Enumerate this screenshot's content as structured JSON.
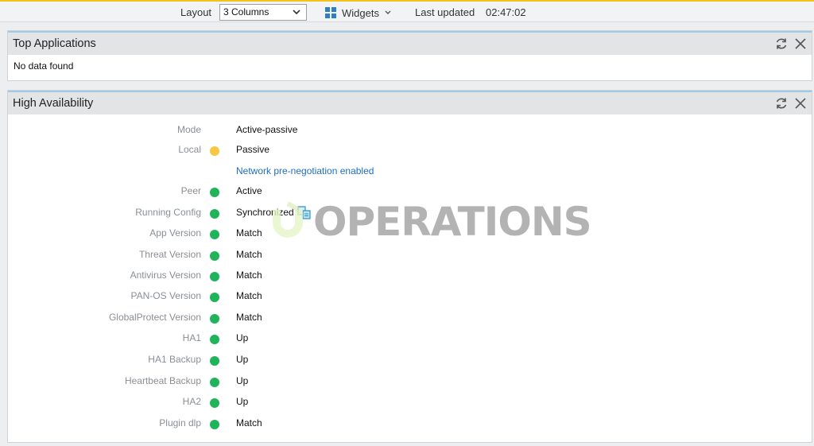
{
  "toolbar": {
    "layout_label": "Layout",
    "layout_value": "3 Columns",
    "widgets_label": "Widgets",
    "last_updated_label": "Last updated",
    "last_updated_value": "02:47:02"
  },
  "top_applications": {
    "title": "Top Applications",
    "empty_message": "No data found"
  },
  "high_availability": {
    "title": "High Availability",
    "rows": [
      {
        "label": "Mode",
        "status": null,
        "value": "Active-passive"
      },
      {
        "label": "Local",
        "status": "yellow",
        "value": "Passive"
      },
      {
        "label": "",
        "status": null,
        "value": "Network pre-negotiation enabled",
        "link": true
      },
      {
        "label": "Peer",
        "status": "green",
        "value": "Active"
      },
      {
        "label": "Running Config",
        "status": "green",
        "value": "Synchronized"
      },
      {
        "label": "App Version",
        "status": "green",
        "value": "Match"
      },
      {
        "label": "Threat Version",
        "status": "green",
        "value": "Match"
      },
      {
        "label": "Antivirus Version",
        "status": "green",
        "value": "Match"
      },
      {
        "label": "PAN-OS Version",
        "status": "green",
        "value": "Match"
      },
      {
        "label": "GlobalProtect Version",
        "status": "green",
        "value": "Match"
      },
      {
        "label": "HA1",
        "status": "green",
        "value": "Up"
      },
      {
        "label": "HA1 Backup",
        "status": "green",
        "value": "Up"
      },
      {
        "label": "Heartbeat Backup",
        "status": "green",
        "value": "Up"
      },
      {
        "label": "HA2",
        "status": "green",
        "value": "Up"
      },
      {
        "label": "Plugin dlp",
        "status": "green",
        "value": "Match"
      }
    ]
  },
  "watermark": {
    "text": "OPERATIONS"
  },
  "colors": {
    "accent_top": "#f1c31b",
    "status_green": "#1fb35a",
    "status_yellow": "#f6c842",
    "link": "#1e6fc0"
  },
  "icons": [
    "chevron-down-icon",
    "widgets-grid-icon",
    "refresh-icon",
    "close-icon",
    "sync-config-icon"
  ]
}
